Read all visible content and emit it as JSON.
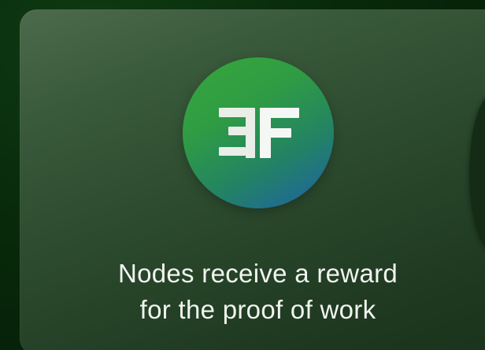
{
  "card": {
    "logo_icon": "ff-monogram-logo",
    "caption_line1": "Nodes receive a reward",
    "caption_line2": "for the proof of work"
  },
  "colors": {
    "background": "#082a0b",
    "card_top": "#4c6a4c",
    "card_bottom": "#1a331c",
    "logo_green": "#37a63a",
    "logo_blue": "#1e5fa8",
    "text": "#f1f4f0"
  }
}
